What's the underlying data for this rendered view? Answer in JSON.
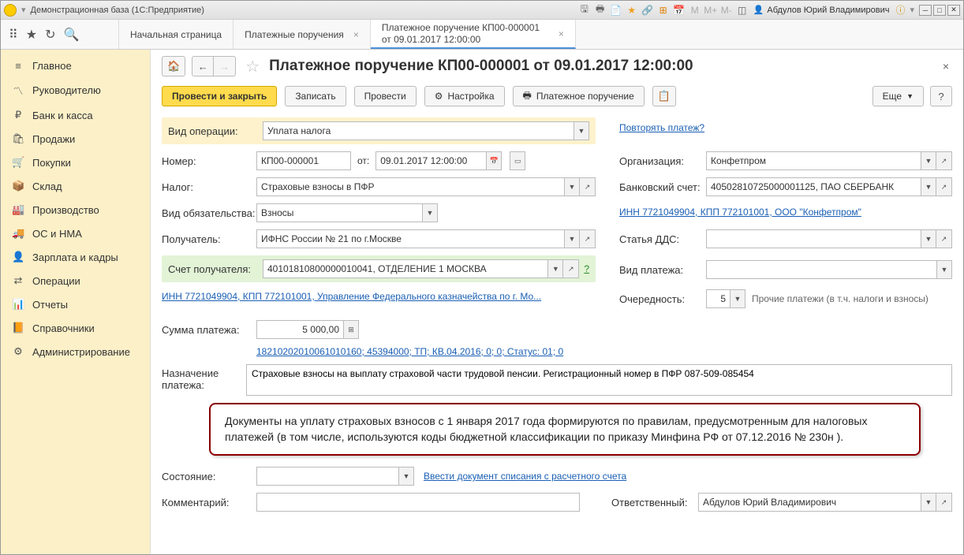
{
  "titlebar": {
    "app_title": "Демонстрационная база  (1С:Предприятие)",
    "user_name": "Абдулов Юрий Владимирович"
  },
  "tabs": {
    "start": "Начальная страница",
    "list": "Платежные поручения",
    "doc": "Платежное поручение КП00-000001 от 09.01.2017 12:00:00"
  },
  "sidebar": {
    "items": [
      {
        "label": "Главное",
        "icon": "≡"
      },
      {
        "label": "Руководителю",
        "icon": "〽"
      },
      {
        "label": "Банк и касса",
        "icon": "₽"
      },
      {
        "label": "Продажи",
        "icon": "🛍"
      },
      {
        "label": "Покупки",
        "icon": "🛒"
      },
      {
        "label": "Склад",
        "icon": "📦"
      },
      {
        "label": "Производство",
        "icon": "🏭"
      },
      {
        "label": "ОС и НМА",
        "icon": "🚚"
      },
      {
        "label": "Зарплата и кадры",
        "icon": "👤"
      },
      {
        "label": "Операции",
        "icon": "⇄"
      },
      {
        "label": "Отчеты",
        "icon": "📊"
      },
      {
        "label": "Справочники",
        "icon": "📙"
      },
      {
        "label": "Администрирование",
        "icon": "⚙"
      }
    ]
  },
  "doc": {
    "title": "Платежное поручение КП00-000001 от 09.01.2017 12:00:00",
    "cmd_post_close": "Провести и закрыть",
    "cmd_save": "Записать",
    "cmd_post": "Провести",
    "cmd_settings": "Настройка",
    "cmd_print": "Платежное поручение",
    "cmd_more": "Еще",
    "cmd_help": "?"
  },
  "fields": {
    "operation_type_lbl": "Вид операции:",
    "operation_type": "Уплата налога",
    "repeat_link": "Повторять платеж?",
    "number_lbl": "Номер:",
    "number": "КП00-000001",
    "from_lbl": "от:",
    "date": "09.01.2017 12:00:00",
    "org_lbl": "Организация:",
    "org": "Конфетпром",
    "tax_lbl": "Налог:",
    "tax": "Страховые взносы в ПФР",
    "bank_lbl": "Банковский счет:",
    "bank": "40502810725000001125, ПАО СБЕРБАНК",
    "obligation_lbl": "Вид обязательства:",
    "obligation": "Взносы",
    "inn_link": "ИНН 7721049904, КПП 772101001, ООО \"Конфетпром\"",
    "recipient_lbl": "Получатель:",
    "recipient": "ИФНС России № 21 по г.Москве",
    "dds_lbl": "Статья ДДС:",
    "dds": "",
    "recip_acct_lbl": "Счет получателя:",
    "recip_acct": "40101810800000010041, ОТДЕЛЕНИЕ 1 МОСКВА",
    "payment_type_lbl": "Вид платежа:",
    "payment_type": "",
    "treasury_link": "ИНН 7721049904, КПП 772101001, Управление Федерального казначейства по г. Мо...",
    "priority_lbl": "Очередность:",
    "priority": "5",
    "priority_hint": "Прочие платежи (в т.ч. налоги и взносы)",
    "amount_lbl": "Сумма платежа:",
    "amount": "5 000,00",
    "kbk_link": "18210202010061010160; 45394000; ТП; КВ.04.2016; 0; 0; Статус: 01; 0",
    "purpose_lbl": "Назначение платежа:",
    "purpose": "Страховые взносы на выплату страховой части трудовой пенсии. Регистрационный номер в ПФР 087-509-085454",
    "status_lbl": "Состояние:",
    "status": "",
    "enter_link": "Ввести документ списания с расчетного счета",
    "comment_lbl": "Комментарий:",
    "comment": "",
    "responsible_lbl": "Ответственный:",
    "responsible": "Абдулов Юрий Владимирович"
  },
  "callout": "Документы на уплату страховых взносов с 1 января 2017 года формируются по правилам, предусмотренным для налоговых платежей (в том числе, используются коды бюджетной классификации по приказу Минфина РФ от 07.12.2016 № 230н )."
}
